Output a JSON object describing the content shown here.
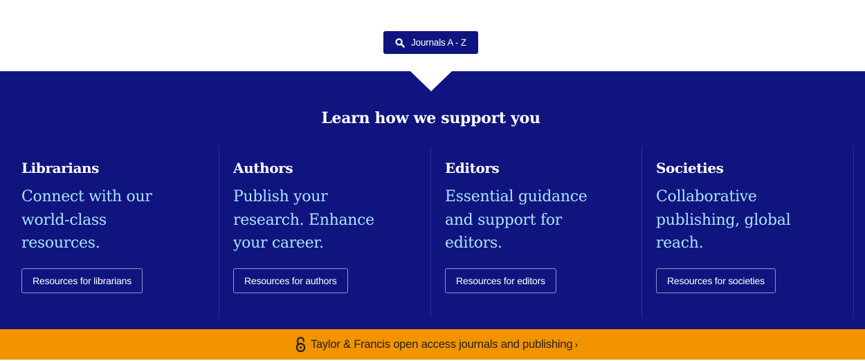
{
  "search": {
    "journals_button_label": "Journals A - Z",
    "icon": "search-icon"
  },
  "support": {
    "heading": "Learn how we support you",
    "columns": [
      {
        "title": "Librarians",
        "tagline": "Connect with our world-class resources.",
        "button_label": "Resources for librarians"
      },
      {
        "title": "Authors",
        "tagline": "Publish your research. Enhance your career.",
        "button_label": "Resources for authors"
      },
      {
        "title": "Editors",
        "tagline": "Essential guidance and support for editors.",
        "button_label": "Resources for editors"
      },
      {
        "title": "Societies",
        "tagline": "Collaborative publishing, global reach.",
        "button_label": "Resources for societies"
      }
    ]
  },
  "open_access": {
    "link_label": "Taylor & Francis open access journals and publishing",
    "chevron": "›",
    "icon": "open-lock-icon"
  },
  "colors": {
    "navy": "#10147e",
    "tagline": "#a9e3ff",
    "oa_bar": "#f29400"
  }
}
